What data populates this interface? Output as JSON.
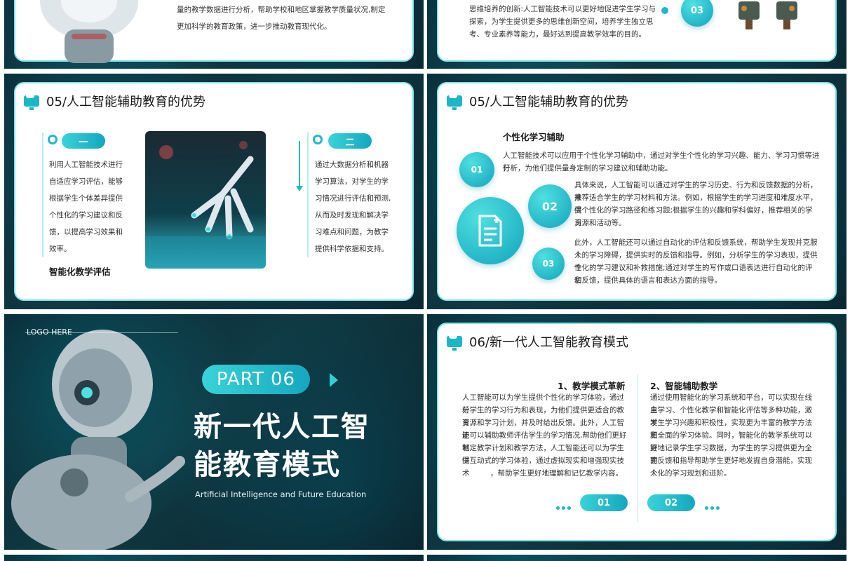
{
  "top_left": {
    "text": "量的教学数据进行分析，帮助学校和地区掌握教学质量状况,制定更加科学的教育政策，进一步推动教育现代化。"
  },
  "top_right": {
    "lines": [
      "思维培养的创新:人工智能技术可以更好地促进学生学习与",
      "探索，为学生提供更多的思维创新空间，培养学生独立思",
      "考、专业素养等能力，最好达到提高教学效率的目的。"
    ],
    "badge": "03"
  },
  "slide_adv1": {
    "title": "05/人工智能辅助教育的优势",
    "left_pill": "一",
    "left_lines": [
      "利用人工智能技术进行",
      "自适应学习评估，能够",
      "根据学生个体差异提供",
      "个性化的学习建议和反",
      "馈，以提高学习效果和",
      "效率。"
    ],
    "left_heading": "智能化教学评估",
    "right_pill": "二",
    "right_lines": [
      "通过大数据分析和机器",
      "学习算法，对学生的学",
      "习情况进行评估和预测,",
      "从而及时发现和解决学",
      "习难点和问题，为教学",
      "提供科学依据和支持。"
    ]
  },
  "slide_adv2": {
    "title": "05/人工智能辅助教育的优势",
    "heading": "个性化学习辅助",
    "c1": "01",
    "c2": "02",
    "c3": "03",
    "p1": [
      "人工智能技术可以应用于个性化学习辅助中，通过对学生个性化的学习兴趣、能力、学习习惯等进行",
      "分析，为他们提供量身定制的学习建议和辅助功能。"
    ],
    "p2": [
      "具体来说，人工智能可以通过对学生的学习历史、行为和反馈数据的分析，来",
      "推荐适合学生的学习材料和方法。例如，根据学生的学习进度和难度水平，提",
      "供个性化的学习路径和练习题;根据学生的兴趣和学科偏好，推荐相关的学习",
      "资源和活动等。"
    ],
    "p3": [
      "此外，人工智能还可以通过自动化的评估和反馈系统，帮助学生发现并克服个",
      "人的学习障碍，提供实时的反馈和指导。例如，分析学生的学习表现，提供个",
      "性化的学习建议和补救措施;通过对学生的写作或口语表达进行自动化的评估",
      "和反馈，提供具体的语言和表达方面的指导。"
    ]
  },
  "slide_part": {
    "logo": "LOGO HERE",
    "part": "PART 06",
    "title_line1": "新一代人工智",
    "title_line2": "能教育模式",
    "subtitle": "Artificial Intelligence and Future Education"
  },
  "slide_mode": {
    "title": "06/新一代人工智能教育模式",
    "left_heading": "1、教学模式革新",
    "left_lines": [
      "人工智能可以为学生提供个性化的学习体验，通过分",
      "析学生的学习行为和表现，为他们提供更适合的教育",
      "资源和学习计划，并及时给出反馈。此外，人工智能",
      "还可以辅助教师评估学生的学习情况,帮助他们更好地",
      "制定教学计划和教学方法，人工智能还可以为学生提",
      "供互动式的学习体验，通过虚拟现实和增强现实技术",
      "，帮助学生更好地理解和记忆教学内容。"
    ],
    "right_heading": "2、智能辅助教学",
    "right_lines": [
      "通过使用智能化的学习系统和平台，可以实现在线自",
      "主学习、个性化教学和智能化评估等多种功能，激发",
      "学生学习兴趣和积极性，实现更为丰富的教学方法和",
      "更全面的学习体验。同时，智能化的教学系统可以更",
      "好地记录学生学习数据，为学生的学习提供更为全面",
      "的反馈和指导帮助学生更好地发掘自身潜能，实现个",
      "人化的学习规划和进阶。"
    ],
    "pill1": "01",
    "pill2": "02"
  }
}
